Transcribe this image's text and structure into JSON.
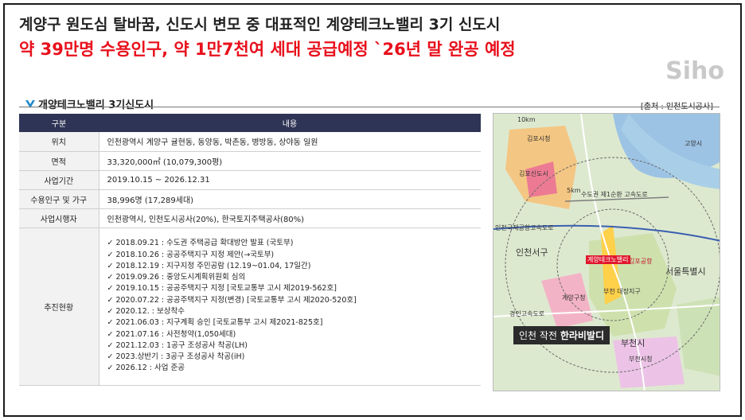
{
  "header": {
    "title": "계양구 원도심 탈바꿈, 신도시 변모 중 대표적인 계양테크노밸리 3기 신도시",
    "headline": "약 39만명 수용인구, 약 1만7천여 세대 공급예정 `26년 말 완공 예정",
    "watermark": "Siho",
    "title_color": "#222222",
    "headline_color": "#e8101c"
  },
  "section": {
    "title": "개양테크노밸리 3기신도시",
    "source": "[출처 : 인천도시공사]",
    "logo_icon": "chevron-logo-icon"
  },
  "table": {
    "headers": [
      "구분",
      "내용"
    ],
    "header_color": "#2e3455",
    "rows": [
      {
        "label": "위치",
        "value": "인천광역시 계양구 귤현동, 동양동, 박촌동, 병방동, 상야동 일원"
      },
      {
        "label": "면적",
        "value": "33,320,000㎡ (10,079,300평)"
      },
      {
        "label": "사업기간",
        "value": "2019.10.15 ~ 2026.12.31"
      },
      {
        "label": "수용인구 및 가구",
        "value": "38,996명 (17,289세대)"
      },
      {
        "label": "사업시행자",
        "value": "인천광역시, 인천도시공사(20%), 한국토지주택공사(80%)"
      }
    ],
    "progress_label": "추진현황",
    "progress": [
      "2018.09.21 : 수도권 주택공급 확대방안 발표 (국토부)",
      "2018.10.26 : 공공주택지구 지정 제안(→국토부)",
      "2018.12.19 : 지구지정 주민공람 (12.19~01.04, 17일간)",
      "2019.09.26 : 중앙도시계획위원회 심의",
      "2019.10.15 : 공공주택지구 지정 [국토교통부 고시 제2019-562호]",
      "2020.07.22 : 공공주택지구 지정(변경) [국토교통부 고시 제2020-520호]",
      "2020.12. : 보상착수",
      "2021.06.03 : 지구계획 승인 [국토교통부 고시 제2021-825호]",
      "2021.07.16 : 사전청약(1,050세대)",
      "2021.12.03 : 1공구 조성공사 착공(LH)",
      "2023.상반기 : 3공구 조성공사 착공(iH)",
      "2026.12 : 사업 준공"
    ]
  },
  "map": {
    "labels": {
      "a": "김포시청",
      "b": "김포신도시",
      "c": "수도권 제1순환 고속도로",
      "d": "인천국제공항고속도로",
      "e": "인천서구",
      "f": "계양테크노밸리",
      "g": "김포공항",
      "h": "서울특별시",
      "i": "계양구청",
      "j": "부천 대장지구",
      "k": "부천시",
      "l": "부천시청",
      "m": "고양시",
      "n": "경인고속도로",
      "o": "10km",
      "p": "5km"
    },
    "banner_prefix": "인천 작전",
    "banner_bold": "한라비발디"
  }
}
